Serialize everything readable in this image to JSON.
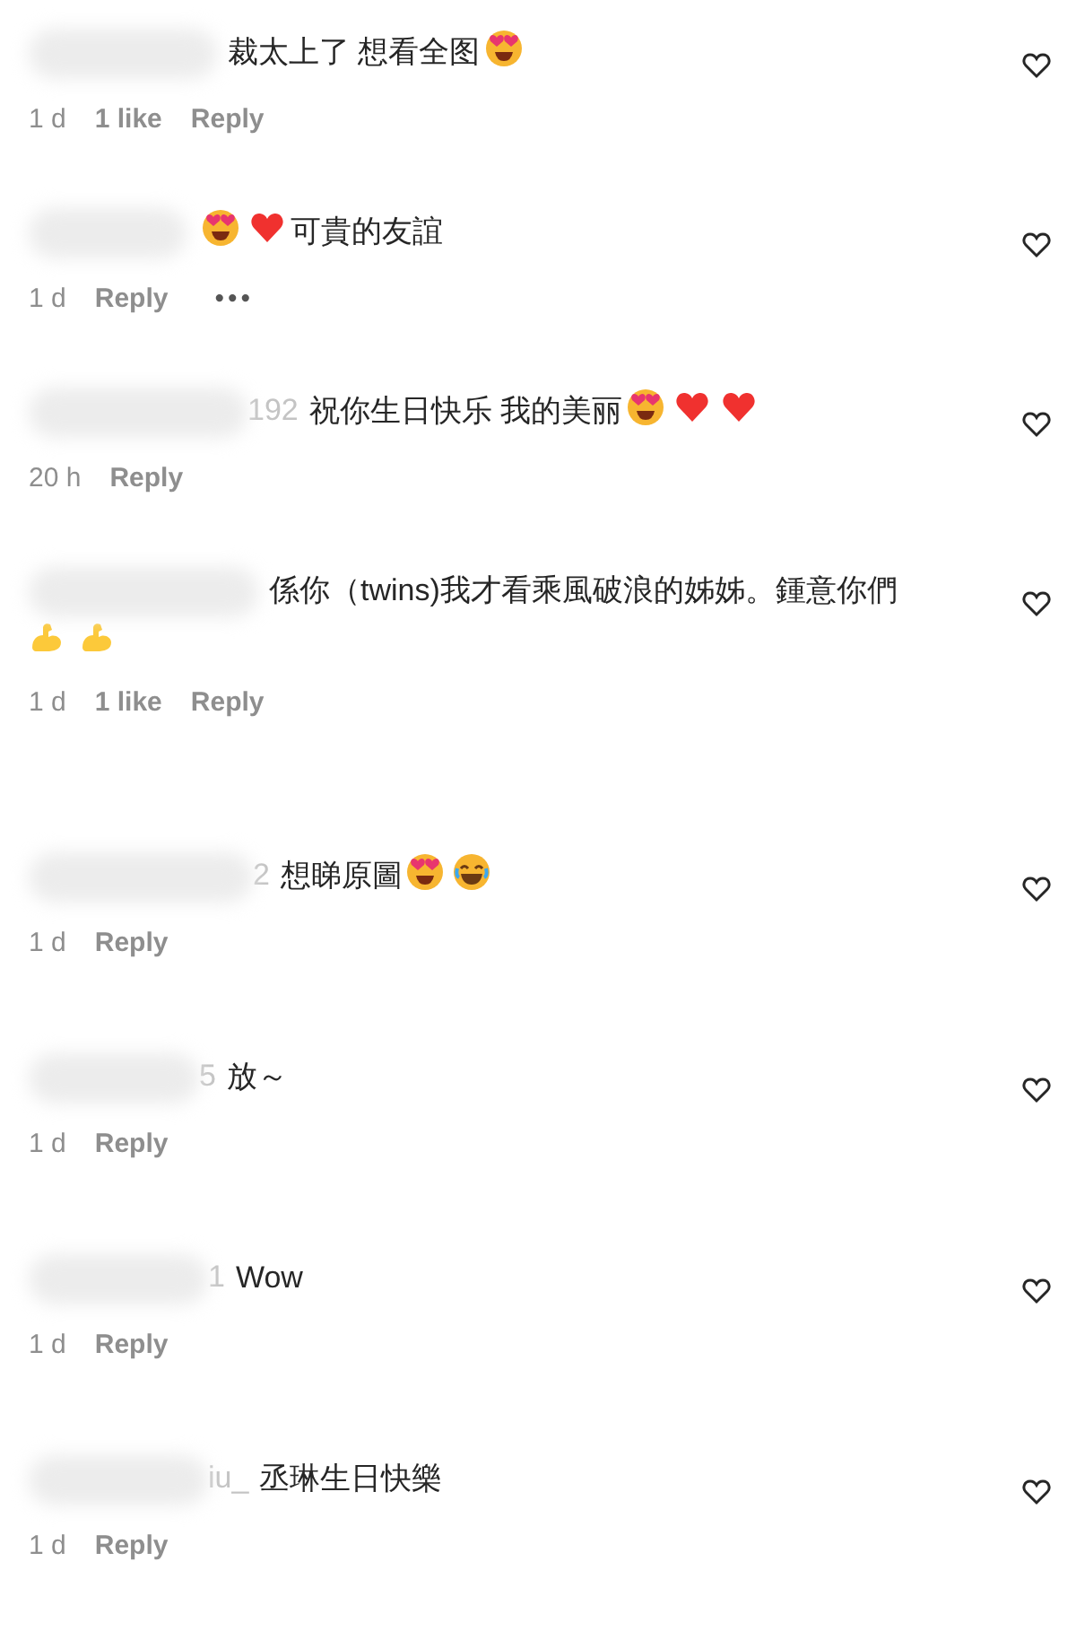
{
  "comments": [
    {
      "parts": [
        {
          "kind": "text",
          "text": "裁太上了 想看全图"
        },
        {
          "kind": "heart-eyes"
        }
      ],
      "meta": [
        {
          "kind": "time",
          "text": "1 d"
        },
        {
          "kind": "likes",
          "text": "1 like"
        },
        {
          "kind": "reply",
          "text": "Reply"
        }
      ]
    },
    {
      "parts": [
        {
          "kind": "heart-eyes"
        },
        {
          "kind": "heart"
        },
        {
          "kind": "text",
          "text": "可貴的友誼"
        }
      ],
      "meta": [
        {
          "kind": "time",
          "text": "1 d"
        },
        {
          "kind": "reply",
          "text": "Reply"
        },
        {
          "kind": "more",
          "text": "•••"
        }
      ]
    },
    {
      "username_fragment": "192",
      "parts": [
        {
          "kind": "text",
          "text": "祝你生日快乐 我的美丽"
        },
        {
          "kind": "heart-eyes"
        },
        {
          "kind": "heart"
        },
        {
          "kind": "heart"
        }
      ],
      "meta": [
        {
          "kind": "time",
          "text": "20 h"
        },
        {
          "kind": "reply",
          "text": "Reply"
        }
      ]
    },
    {
      "parts": [
        {
          "kind": "text",
          "text": "係你（twins)我才看乘風破浪的姊姊。鍾意你們"
        },
        {
          "kind": "muscle"
        },
        {
          "kind": "muscle"
        }
      ],
      "meta": [
        {
          "kind": "time",
          "text": "1 d"
        },
        {
          "kind": "likes",
          "text": "1 like"
        },
        {
          "kind": "reply",
          "text": "Reply"
        }
      ]
    },
    {
      "username_fragment": "2",
      "parts": [
        {
          "kind": "text",
          "text": "想睇原圖"
        },
        {
          "kind": "heart-eyes"
        },
        {
          "kind": "laugh"
        }
      ],
      "meta": [
        {
          "kind": "time",
          "text": "1 d"
        },
        {
          "kind": "reply",
          "text": "Reply"
        }
      ]
    },
    {
      "username_fragment": "5",
      "parts": [
        {
          "kind": "text",
          "text": "放～"
        }
      ],
      "meta": [
        {
          "kind": "time",
          "text": "1 d"
        },
        {
          "kind": "reply",
          "text": "Reply"
        }
      ]
    },
    {
      "username_fragment": "1",
      "parts": [
        {
          "kind": "text",
          "text": "Wow"
        }
      ],
      "meta": [
        {
          "kind": "time",
          "text": "1 d"
        },
        {
          "kind": "reply",
          "text": "Reply"
        }
      ]
    },
    {
      "username_fragment": "iu_",
      "parts": [
        {
          "kind": "text",
          "text": "丞琳生日快樂"
        }
      ],
      "meta": [
        {
          "kind": "time",
          "text": "1 d"
        },
        {
          "kind": "reply",
          "text": "Reply"
        }
      ]
    }
  ]
}
